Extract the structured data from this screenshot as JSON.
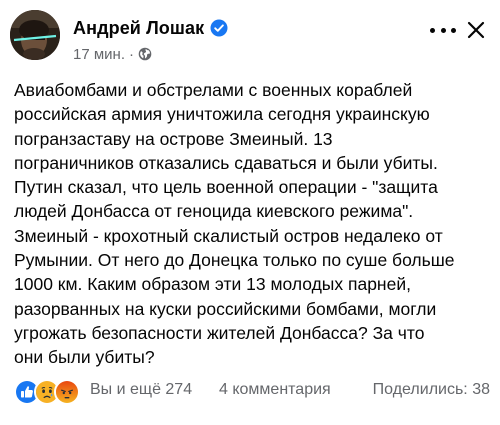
{
  "post": {
    "author": "Андрей Лошак",
    "time": "17 мин.",
    "meta_separator": "·",
    "body_lines": [
      "Авиабомбами и обстрелами с военных кораблей",
      "российская армия уничтожила сегодня украинскую",
      "погранзаставу на  острове Змеиный. 13",
      "пограничников отказались сдаваться и были убиты.",
      "Путин сказал, что цель военной операции  - \"защита",
      "людей Донбасса от геноцида киевского режима\".",
      "Змеиный - крохотный скалистый остров недалеко от",
      "Румынии. От него до Донецка только по суше больше",
      "1000 км. Каким образом эти 13 молодых парней,",
      "разорванных на куски российскими бомбами, могли",
      "угрожать безопасности жителей Донбасса? За что",
      "они были убиты?"
    ]
  },
  "icons": {
    "verified": "verified-badge-icon",
    "audience": "globe-icon",
    "more": "more-options-icon",
    "close": "close-icon",
    "reactions": [
      "like-reaction-icon",
      "sad-reaction-icon",
      "angry-reaction-icon"
    ]
  },
  "engagement": {
    "reaction_summary": "Вы и ещё 274",
    "comments": "4 комментария",
    "shares": "Поделились: 38"
  },
  "colors": {
    "text_primary": "#050505",
    "text_secondary": "#65676b",
    "verified_blue": "#1877f2",
    "like_blue": "#1877f2",
    "sad_yellow": "#f7b125",
    "angry_orange": "#e9710f"
  }
}
